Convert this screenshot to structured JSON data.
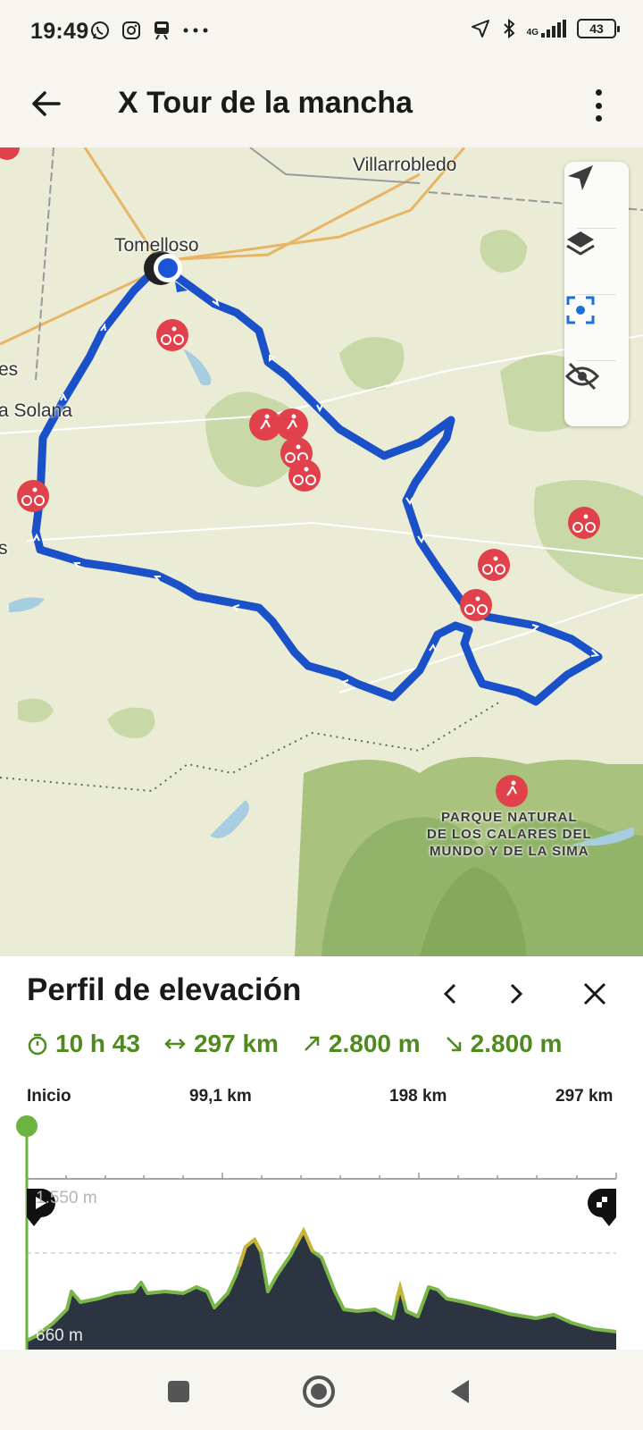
{
  "status_bar": {
    "time": "19:49",
    "battery": "43",
    "network": "4G",
    "icons_left": [
      "whatsapp-icon",
      "instagram-icon",
      "train-icon",
      "more-notifications-icon"
    ],
    "icons_right": [
      "location-arrow-icon",
      "bluetooth-icon",
      "signal-icon",
      "battery-icon"
    ]
  },
  "app_bar": {
    "title": "X Tour de la mancha",
    "back_icon": "arrow-left-icon",
    "menu_icon": "more-vertical-icon"
  },
  "map": {
    "labels": {
      "villarrobledo": "Villarrobledo",
      "tomelloso": "Tomelloso",
      "la_solana": "a Solana",
      "edge_es": "es",
      "edge_s": "s",
      "park": "PARQUE NATURAL\nDE LOS CALARES DEL\nMUNDO Y DE LA SIMA"
    },
    "controls": [
      "navigate-arrow-icon",
      "layers-icon",
      "recenter-icon",
      "visibility-off-icon"
    ],
    "route_color": "#1a50c8",
    "poi_color": "#e0414b"
  },
  "elevation": {
    "title": "Perfil de elevación",
    "nav": [
      "chevron-left-icon",
      "chevron-right-icon",
      "close-icon"
    ],
    "stats": {
      "duration": "10 h 43",
      "distance": "297 km",
      "ascent": "2.800 m",
      "descent": "2.800 m"
    },
    "axis": {
      "start": "Inicio",
      "km1": "99,1 km",
      "km2": "198 km",
      "km3": "297 km"
    },
    "max_label": "1.550 m",
    "min_label": "660 m",
    "accent_color": "#6db33f",
    "fill_color": "#2b3440"
  },
  "nav_bar": {
    "buttons": [
      "recents-square-icon",
      "home-circle-icon",
      "back-triangle-icon"
    ]
  }
}
